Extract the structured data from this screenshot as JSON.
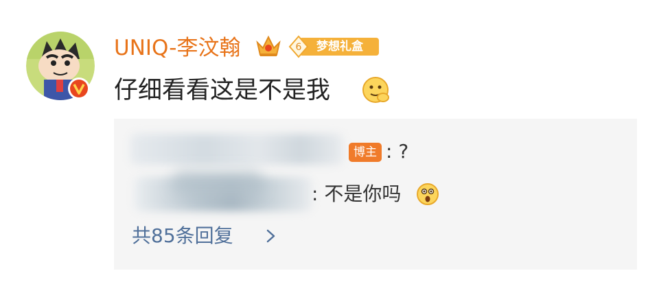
{
  "comment": {
    "username": "UNIQ-李汶翰",
    "level_number": "6",
    "level_badge_text": "梦想礼盒",
    "text": "仔细看看这是不是我",
    "verified_mark": "V"
  },
  "replies": [
    {
      "author_badge": "博主",
      "text": ": ?"
    },
    {
      "text": ": 不是你吗"
    }
  ],
  "more_replies_label": "共85条回复",
  "colors": {
    "username": "#e8741a",
    "host_badge": "#f07b2a",
    "link": "#50709a",
    "reply_bg": "#f5f5f5"
  },
  "icons": [
    "avatar-cartoon",
    "verified-badge-icon",
    "crown-icon",
    "level-badge-icon",
    "thinking-emoji-icon",
    "shocked-emoji-icon",
    "chevron-right-icon"
  ]
}
